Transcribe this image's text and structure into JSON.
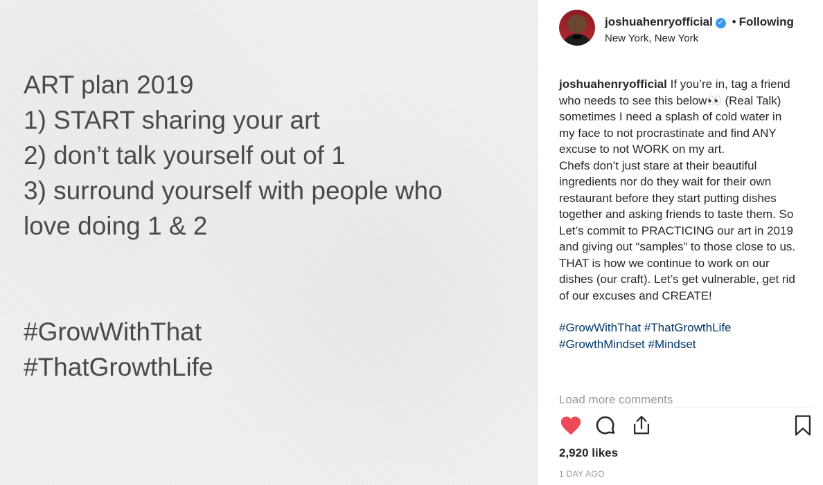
{
  "image": {
    "lines": [
      "ART plan 2019",
      "1) START sharing your art",
      "2) don’t talk yourself out of 1",
      "3) surround yourself with people who",
      "love doing 1 & 2"
    ],
    "hashtags": [
      "#GrowWithThat",
      "#ThatGrowthLife"
    ]
  },
  "header": {
    "username": "joshuahenryofficial",
    "separator": "•",
    "follow_status": "Following",
    "location": "New York, New York"
  },
  "caption": {
    "username": "joshuahenryofficial",
    "paragraph1": " If you’re in, tag a friend who needs to see this below👀 (Real Talk) sometimes I need a splash of cold water in my face to not procrastinate and find ANY excuse to not WORK on my art.",
    "paragraph2": "Chefs don’t just stare at their beautiful ingredients nor do they wait for their own restaurant before they start putting dishes together and asking friends to taste them. So Let’s commit to PRACTICING our art in 2019 and giving out “samples” to those close to us. THAT is how we continue to work on our dishes (our craft). Let’s get vulnerable, get rid of our excuses and CREATE!",
    "hashtags": [
      "#GrowWithThat",
      "#ThatGrowthLife",
      "#GrowthMindset",
      "#Mindset"
    ]
  },
  "load_more": "Load more comments",
  "likes": "2,920 likes",
  "timestamp": "1 DAY AGO",
  "icons": {
    "like": "heart-icon",
    "comment": "comment-icon",
    "share": "share-icon",
    "save": "bookmark-icon",
    "verified": "verified-badge-icon"
  },
  "colors": {
    "like": "#ed4956",
    "hashtag": "#003569",
    "verified": "#3897f0",
    "muted": "#999999"
  }
}
